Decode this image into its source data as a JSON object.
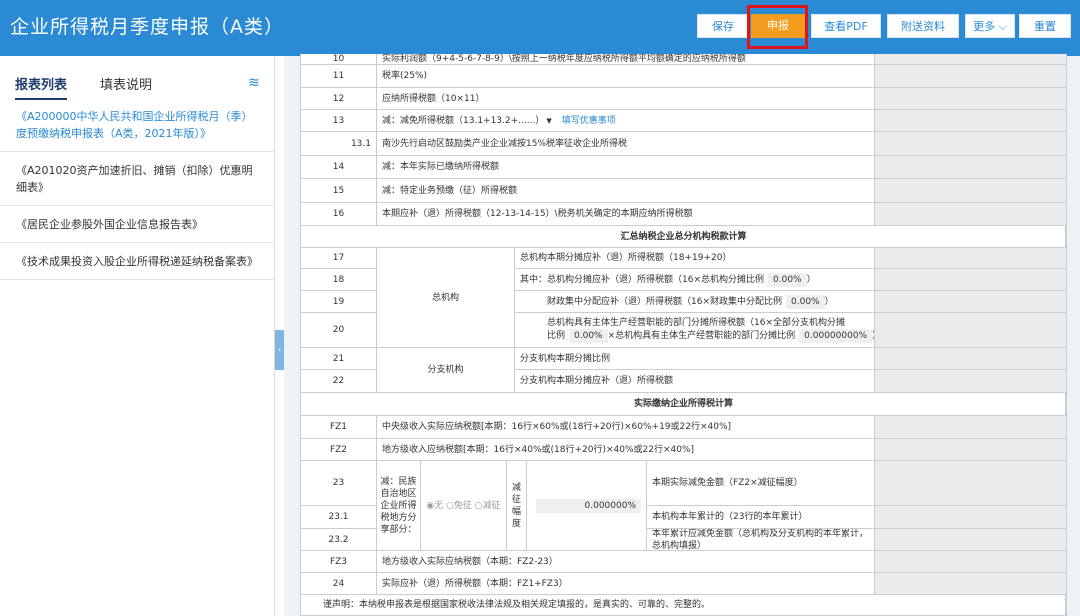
{
  "header": {
    "title": "企业所得税月季度申报（A类）",
    "buttons": [
      "保存",
      "申报",
      "查看PDF",
      "附送资料",
      "更多",
      "重置"
    ]
  },
  "sidebar": {
    "tabs": [
      "报表列表",
      "填表说明"
    ],
    "items": [
      "《A200000中华人民共和国企业所得税月（季）度预缴纳税申报表（A类，2021年版）》",
      "《A201020资产加速折旧、摊销（扣除）优惠明细表》",
      "《居民企业参股外国企业信息报告表》",
      "《技术成果投资入股企业所得税递延纳税备案表》"
    ]
  },
  "table": {
    "r10": {
      "num": "10",
      "label": "实际利润额（9+4-5-6-7-8-9）\\按照上一纳税年度应纳税所得额平均额确定的应纳税所得额"
    },
    "r11": {
      "num": "11",
      "label": "税率(25%)"
    },
    "r12": {
      "num": "12",
      "label": "应纳所得税额（10×11）"
    },
    "r13": {
      "num": "13",
      "label": "减：减免所得税额（13.1+13.2+......）",
      "link": "填写优惠事项"
    },
    "r131": {
      "num": "13.1",
      "label": "南沙先行启动区鼓励类产业企业减按15%税率征收企业所得税"
    },
    "r14": {
      "num": "14",
      "label": "减：本年实际已缴纳所得税额"
    },
    "r15": {
      "num": "15",
      "label": "减：特定业务预缴（征）所得税额"
    },
    "r16": {
      "num": "16",
      "label": "本期应补（退）所得税额（12-13-14-15）\\税务机关确定的本期应纳所得税额"
    },
    "sec1": "汇总纳税企业总分机构税款计算",
    "r17": {
      "num": "17",
      "label": "总机构本期分摊应补（退）所得税额（18+19+20）"
    },
    "r18": {
      "num": "18",
      "label": "其中：总机构分摊应补（退）所得税额（16×总机构分摊比例",
      "val": "0.00%",
      "end": "）"
    },
    "r19": {
      "num": "19",
      "label": "财政集中分配应补（退）所得税额（16×财政集中分配比例",
      "val": "0.00%",
      "end": "）"
    },
    "r20": {
      "num": "20",
      "label1": "总机构具有主体生产经营职能的部门分摊所得税额（16×全部分支机构分摊",
      "label2": "比例",
      "val1": "0.00%",
      "mid": "×总机构具有主体生产经营职能的部门分摊比例",
      "val2": "0.00000000%",
      "end": "）"
    },
    "zjg": "总机构",
    "r21": {
      "num": "21",
      "label": "分支机构本期分摊比例"
    },
    "r22": {
      "num": "22",
      "label": "分支机构本期分摊应补（退）所得税额"
    },
    "fzjg": "分支机构",
    "sec2": "实际缴纳企业所得税计算",
    "fz1": {
      "num": "FZ1",
      "label": "中央级收入实际应纳税额[本期：16行×60%或(18行+20行)×60%+19或22行×40%]"
    },
    "fz2": {
      "num": "FZ2",
      "label": "地方级收入应纳税额[本期：16行×40%或(18行+20行)×40%或22行×40%]"
    },
    "r23": {
      "num": "23",
      "label": "本期实际减免金额（FZ2×减征幅度）"
    },
    "r231": {
      "num": "23.1",
      "label": "本机构本年累计的（23行的本年累计）"
    },
    "r232": {
      "num": "23.2",
      "label": "本年累计应减免金额（总机构及分支机构的本年累计，总机构填报）"
    },
    "minzu": "减：民族自治地区企业所得税地方分享部分：",
    "radio1": "◉无",
    "radio2": "○免征",
    "radio3": "○减征",
    "jzfd": "减征幅度",
    "jzval": "0.000000%",
    "fz3": {
      "num": "FZ3",
      "label": "地方级收入实际应纳税额（本期：FZ2-23）"
    },
    "r24": {
      "num": "24",
      "label": "实际应补（退）所得税额（本期：FZ1+FZ3）"
    },
    "decl": "谨声明：本纳税申报表是根据国家税收法律法规及相关规定填报的，是真实的、可靠的、完整的。"
  },
  "colors": {
    "header": "#2a8ad4",
    "active_button": "#f39c1e",
    "highlight": "#e3131a"
  }
}
